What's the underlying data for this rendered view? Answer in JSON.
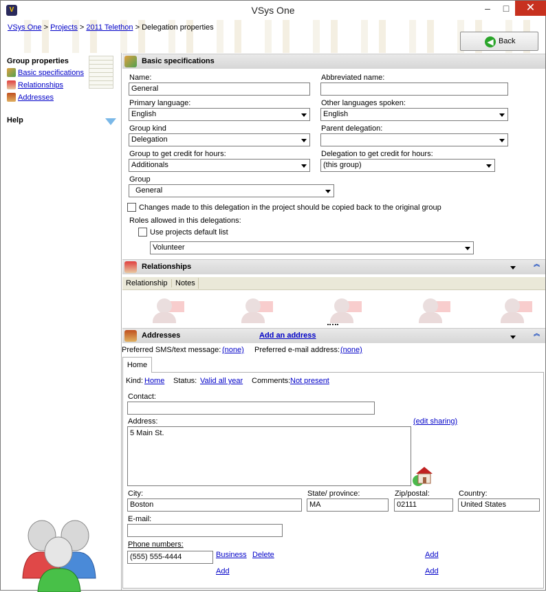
{
  "window": {
    "title": "VSys One",
    "minimize": "–",
    "maximize": "□",
    "close": "✕"
  },
  "breadcrumb": {
    "items": [
      "VSys One",
      "Projects",
      "2011 Telethon"
    ],
    "current": "Delegation properties",
    "sep": ">"
  },
  "back_button": {
    "label": "Back"
  },
  "left_pane": {
    "title": "Group properties",
    "items": [
      {
        "label": "Basic specifications",
        "icon": "people-icon"
      },
      {
        "label": "Relationships",
        "icon": "relationship-icon"
      },
      {
        "label": "Addresses",
        "icon": "house-icon"
      }
    ],
    "help": "Help"
  },
  "basic": {
    "header": "Basic specifications",
    "name_label": "Name:",
    "name_value": "General",
    "abbr_label": "Abbreviated name:",
    "abbr_value": "",
    "primary_lang_label": "Primary language:",
    "primary_lang_value": "English",
    "other_lang_label": "Other languages spoken:",
    "other_lang_value": "English",
    "group_kind_label": "Group kind",
    "group_kind_value": "Delegation",
    "parent_label": "Parent delegation:",
    "parent_value": "",
    "credit_group_label": "Group to get credit for hours:",
    "credit_group_value": "Additionals",
    "credit_deleg_label": "Delegation to get credit for hours:",
    "credit_deleg_value": "(this group)",
    "group_label": "Group",
    "group_value": "General",
    "copy_back_label": "Changes made to this delegation in the project should be copied back to the original group",
    "roles_label": "Roles allowed in this delegations:",
    "use_default_label": "Use projects default list",
    "roles_value": "Volunteer"
  },
  "relationships": {
    "header": "Relationships",
    "columns": [
      "Relationship",
      "Notes"
    ]
  },
  "addresses": {
    "header": "Addresses",
    "add_link": "Add an address",
    "pref_sms_label": "Preferred SMS/text message:",
    "pref_sms_value": "(none)",
    "pref_email_label": "Preferred e-mail address:",
    "pref_email_value": "(none)",
    "tab": "Home",
    "kind_label": "Kind:",
    "kind_value": "Home",
    "status_label": "Status:",
    "status_value": "Valid all year",
    "comments_label": "Comments:",
    "comments_value": "Not present",
    "contact_label": "Contact:",
    "contact_value": "",
    "address_label": "Address:",
    "address_value": "5 Main St.",
    "edit_sharing": "(edit sharing)",
    "city_label": "City:",
    "city_value": "Boston",
    "state_label": "State/ province:",
    "state_value": "MA",
    "zip_label": "Zip/postal:",
    "zip_value": "02111",
    "country_label": "Country:",
    "country_value": "United States",
    "email_label": "E-mail:",
    "email_value": "",
    "phone_label": "Phone numbers:",
    "phone_value": "(555) 555-4444",
    "phone_type": "Business",
    "delete": "Delete",
    "add": "Add"
  },
  "colors": {
    "link": "#0000c8",
    "close_button": "#c7311f",
    "header_gray": "#d6d6d6"
  }
}
